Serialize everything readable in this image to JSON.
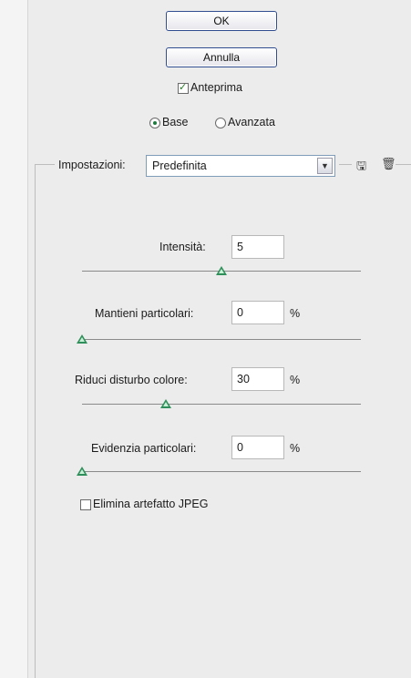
{
  "buttons": {
    "ok": "OK",
    "cancel": "Annulla"
  },
  "preview": {
    "label": "Anteprima",
    "checked": true
  },
  "mode": {
    "basic": "Base",
    "advanced": "Avanzata",
    "selected": "basic"
  },
  "settings": {
    "label": "Impostazioni:",
    "value": "Predefinita"
  },
  "sliders": [
    {
      "label": "Intensità:",
      "value": "5",
      "unit": "",
      "level": 0.5
    },
    {
      "label": "Mantieni particolari:",
      "value": "0",
      "unit": "%",
      "level": 0.0
    },
    {
      "label": "Riduci disturbo colore:",
      "value": "30",
      "unit": "%",
      "level": 0.3
    },
    {
      "label": "Evidenzia particolari:",
      "value": "0",
      "unit": "%",
      "level": 0.0
    }
  ],
  "jpeg": {
    "label": "Elimina artefatto JPEG",
    "checked": false
  },
  "icons": {
    "save": "save-settings-icon",
    "delete": "delete-settings-icon"
  },
  "colors": {
    "accent": "#2f4d8f",
    "thumb": "#2e8f5a"
  }
}
